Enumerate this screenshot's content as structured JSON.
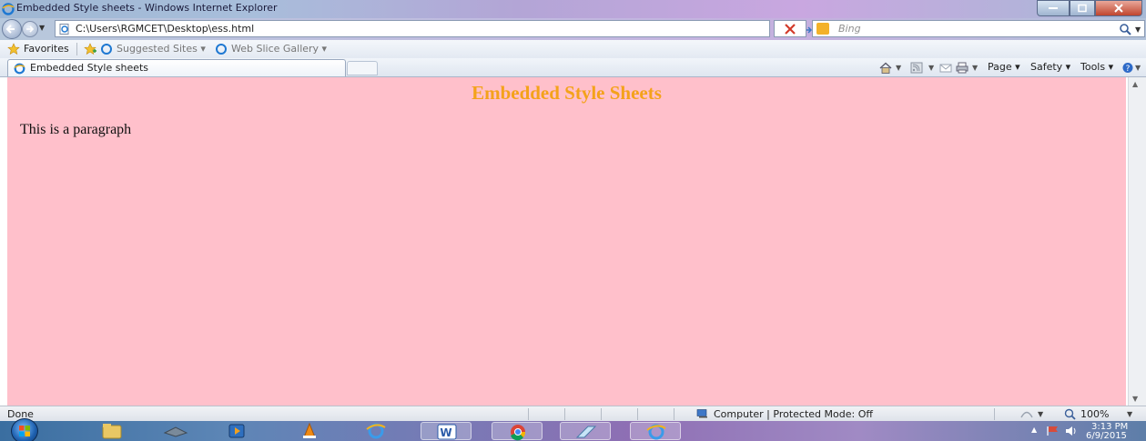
{
  "window": {
    "title": "Embedded Style sheets - Windows Internet Explorer"
  },
  "address_bar": {
    "url": "C:\\Users\\RGMCET\\Desktop\\ess.html",
    "search_placeholder": "Bing"
  },
  "favorites_bar": {
    "favorites_label": "Favorites",
    "items": [
      "Suggested Sites ▾",
      "Web Slice Gallery ▾"
    ]
  },
  "tabs": [
    {
      "label": "Embedded Style sheets",
      "active": true
    }
  ],
  "command_bar": {
    "page_label": "Page ▾",
    "safety_label": "Safety ▾",
    "tools_label": "Tools ▾"
  },
  "page": {
    "background_color": "#ffc0cb",
    "heading": "Embedded Style Sheets",
    "heading_color": "#f4a21a",
    "paragraph": "This is a paragraph"
  },
  "status_bar": {
    "status": "Done",
    "zone": "Computer | Protected Mode: Off",
    "zoom": "100%"
  },
  "taskbar": {
    "time": "3:13 PM",
    "date": "6/9/2015",
    "pinned_apps": [
      "explorer",
      "network",
      "media-player",
      "vlc",
      "internet-explorer",
      "word",
      "chrome",
      "notepad",
      "internet-explorer-active"
    ]
  }
}
